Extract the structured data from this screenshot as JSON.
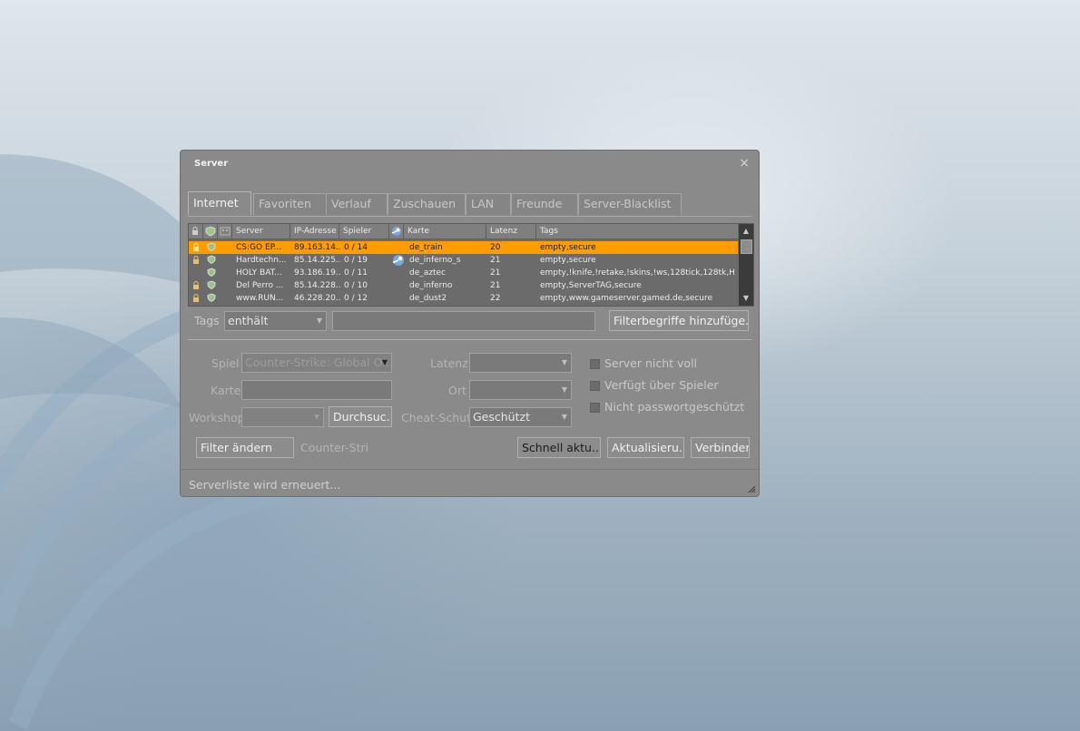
{
  "window": {
    "title": "Server",
    "close_glyph": "×",
    "tabs": [
      {
        "label": "Internet",
        "active": true
      },
      {
        "label": "Favoriten"
      },
      {
        "label": "Verlauf"
      },
      {
        "label": "Zuschauen"
      },
      {
        "label": "LAN"
      },
      {
        "label": "Freunde"
      },
      {
        "label": "Server-Blacklist"
      }
    ]
  },
  "server_list": {
    "columns": [
      "Server",
      "IP-Adresse",
      "Spieler",
      "Karte",
      "Latenz",
      "Tags"
    ],
    "header_icons": [
      "lock-icon",
      "shield-icon",
      "bot-icon",
      "steam-icon"
    ],
    "rows": [
      {
        "locked": true,
        "secure": true,
        "steam": false,
        "server": "CS:GO EP...",
        "ip": "89.163.14...",
        "players": "0 / 14",
        "map": "de_train",
        "latency": "20",
        "tags": "empty,secure",
        "selected": true
      },
      {
        "locked": true,
        "secure": true,
        "steam": true,
        "server": "Hardtechn...",
        "ip": "85.14.225...",
        "players": "0 / 19",
        "map": "de_inferno_s",
        "latency": "21",
        "tags": "empty,secure"
      },
      {
        "locked": false,
        "secure": true,
        "steam": false,
        "server": "HOLY BAT...",
        "ip": "93.186.19...",
        "players": "0 / 11",
        "map": "de_aztec",
        "latency": "21",
        "tags": "empty,!knife,!retake,!skins,!ws,128tick,128tk,HL..."
      },
      {
        "locked": true,
        "secure": true,
        "steam": false,
        "server": "Del Perro ...",
        "ip": "85.14.228...",
        "players": "0 / 10",
        "map": "de_inferno",
        "latency": "21",
        "tags": "empty,ServerTAG,secure"
      },
      {
        "locked": true,
        "secure": true,
        "steam": false,
        "server": "www.RUN...",
        "ip": "46.228.20...",
        "players": "0 / 12",
        "map": "de_dust2",
        "latency": "22",
        "tags": "empty,www.gameserver.gamed.de,secure"
      }
    ]
  },
  "tags_filter": {
    "label": "Tags",
    "mode": "enthält",
    "text": "",
    "add_button": "Filterbegriffe hinzufüge..."
  },
  "filters": {
    "game_label": "Spiel",
    "game_value": "Counter-Strike: Global O...",
    "map_label": "Karte",
    "map_value": "",
    "workshop_label": "Workshop",
    "workshop_value": "",
    "browse_button": "Durchsuc...",
    "latency_label": "Latenz",
    "latency_value": "",
    "location_label": "Ort",
    "location_value": "",
    "anticheat_label": "Cheat-Schut",
    "anticheat_value": "Geschützt",
    "not_full_label": "Server nicht voll",
    "has_players_label": "Verfügt über Spieler",
    "not_password_label": "Nicht passwortgeschützt"
  },
  "actions": {
    "change_filter": "Filter ändern",
    "filter_summary": "Counter-Stri",
    "quick_refresh": "Schnell aktu...",
    "refresh": "Aktualisieru...",
    "connect": "Verbinden"
  },
  "status": {
    "text": "Serverliste wird erneuert..."
  },
  "colors": {
    "selection": "#ff9c00",
    "panel": "#8a8a8a",
    "list_bg": "#6b6b6b"
  }
}
